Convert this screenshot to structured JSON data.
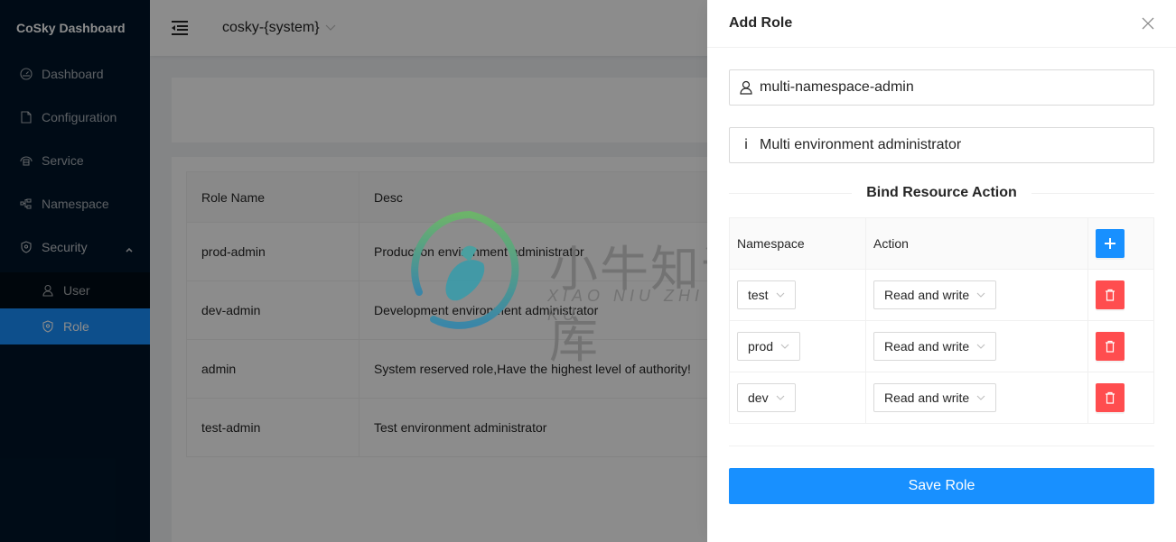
{
  "app": {
    "title": "CoSky Dashboard"
  },
  "sidebar": {
    "items": [
      {
        "label": "Dashboard",
        "icon": "dashboard-icon"
      },
      {
        "label": "Configuration",
        "icon": "file-icon"
      },
      {
        "label": "Service",
        "icon": "service-icon"
      },
      {
        "label": "Namespace",
        "icon": "namespace-icon"
      },
      {
        "label": "Security",
        "icon": "shield-icon",
        "expanded": true
      }
    ],
    "security_children": [
      {
        "label": "User",
        "icon": "user-icon"
      },
      {
        "label": "Role",
        "icon": "shield-icon",
        "active": true
      }
    ]
  },
  "header": {
    "namespace": "cosky-{system}"
  },
  "roles_table": {
    "columns": [
      "Role Name",
      "Desc"
    ],
    "rows": [
      {
        "name": "prod-admin",
        "desc": "Production environment administrator"
      },
      {
        "name": "dev-admin",
        "desc": "Development environment administrator"
      },
      {
        "name": "admin",
        "desc": "System reserved role,Have the highest level of authority!"
      },
      {
        "name": "test-admin",
        "desc": "Test environment administrator"
      }
    ]
  },
  "watermark": {
    "cn": "小牛知识库",
    "en": "XIAO NIU ZHI SHI KU"
  },
  "drawer": {
    "title": "Add Role",
    "role_name": "multi-namespace-admin",
    "role_desc": "Multi environment administrator",
    "bind_title": "Bind Resource Action",
    "columns": {
      "namespace": "Namespace",
      "action": "Action"
    },
    "bindings": [
      {
        "namespace": "test",
        "action": "Read and write"
      },
      {
        "namespace": "prod",
        "action": "Read and write"
      },
      {
        "namespace": "dev",
        "action": "Read and write"
      }
    ],
    "save_label": "Save Role"
  },
  "colors": {
    "primary": "#1890ff",
    "danger": "#ff4d4f",
    "sidebar": "#001529"
  }
}
